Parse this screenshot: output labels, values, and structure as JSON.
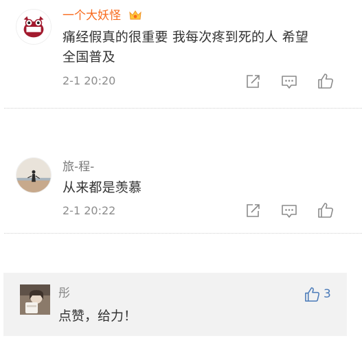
{
  "comments": [
    {
      "user": "一个大妖怪",
      "content_line1": "痛经假真的很重要 我每次疼到死的人 希望",
      "content_line2": "全国普及",
      "time": "2-1 20:20"
    },
    {
      "user": "旅-程-",
      "content_line1": "从来都是羡慕",
      "time": "2-1 20:22"
    }
  ],
  "reply": {
    "user": "彤",
    "content": "点赞，给力！",
    "like_count": "3"
  },
  "icons": {
    "repost": "repost-icon",
    "comment": "comment-icon",
    "like": "thumbs-up-icon"
  },
  "colors": {
    "vip_name": "#f86a1c",
    "name": "#777777",
    "text": "#333333",
    "time": "#8c8c8c",
    "icon": "#8a8a8a",
    "like_blue": "#4a7ab8",
    "reply_bg": "#f2f2f2"
  }
}
